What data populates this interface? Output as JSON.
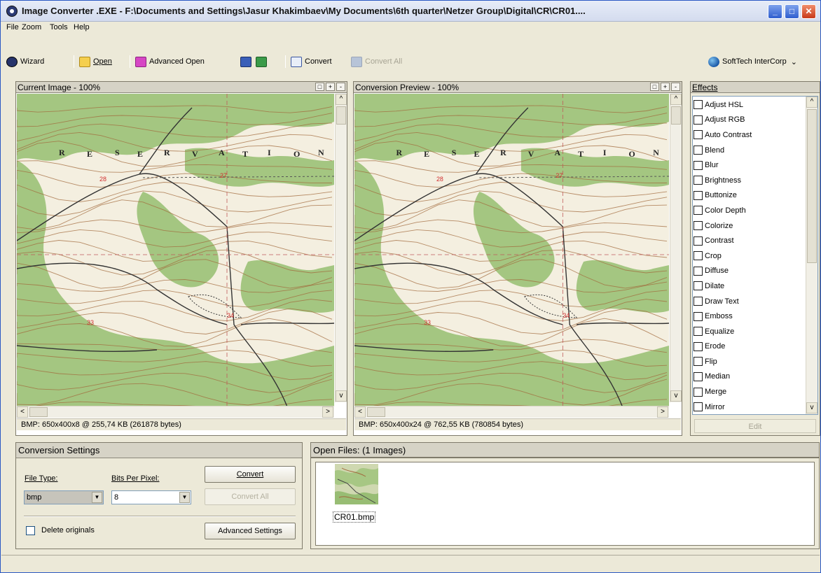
{
  "window": {
    "title": "Image Converter .EXE - F:\\Documents and Settings\\Jasur Khakimbaev\\My Documents\\6th quarter\\Netzer Group\\Digital\\CR\\CR01....",
    "minimize": "_",
    "maximize": "□",
    "close": "✕"
  },
  "menu": [
    "File",
    "Zoom",
    "Tools",
    "Help"
  ],
  "toolbar": {
    "wizard": "Wizard",
    "open": "Open",
    "advanced_open": "Advanced Open",
    "convert": "Convert",
    "convert_all": "Convert All",
    "brand": "SoftTech InterCorp"
  },
  "current_pane": {
    "title": "Current Image - 100%",
    "status": "BMP: 650x400x8 @ 255,74 KB (261878 bytes)"
  },
  "preview_pane": {
    "title": "Conversion Preview - 100%",
    "status": "BMP: 650x400x24 @ 762,55 KB (780854 bytes)"
  },
  "map": {
    "labels": [
      "R",
      "E",
      "S",
      "E",
      "R",
      "V",
      "A",
      "T",
      "I",
      "O",
      "N"
    ],
    "section_numbers": [
      "28",
      "27",
      "33",
      "34"
    ]
  },
  "effects": {
    "title": "Effects",
    "items": [
      "Adjust HSL",
      "Adjust RGB",
      "Auto Contrast",
      "Blend",
      "Blur",
      "Brightness",
      "Buttonize",
      "Color Depth",
      "Colorize",
      "Contrast",
      "Crop",
      "Diffuse",
      "Dilate",
      "Draw Text",
      "Emboss",
      "Equalize",
      "Erode",
      "Flip",
      "Median",
      "Merge",
      "Mirror"
    ],
    "edit_button": "Edit"
  },
  "conversion_settings": {
    "title": "Conversion Settings",
    "file_type_label": "File Type:",
    "file_type_value": "bmp",
    "bits_label": "Bits Per Pixel:",
    "bits_value": "8",
    "convert_button": "Convert",
    "convert_all_button": "Convert All",
    "delete_originals": "Delete originals",
    "advanced_settings_button": "Advanced Settings"
  },
  "open_files": {
    "title": "Open Files: (1 Images)",
    "files": [
      {
        "name": "CR01.bmp"
      }
    ]
  },
  "colors": {
    "map_green": "#9fc37b",
    "map_cream": "#f4efe0",
    "contour_brown": "#a16a3c"
  }
}
